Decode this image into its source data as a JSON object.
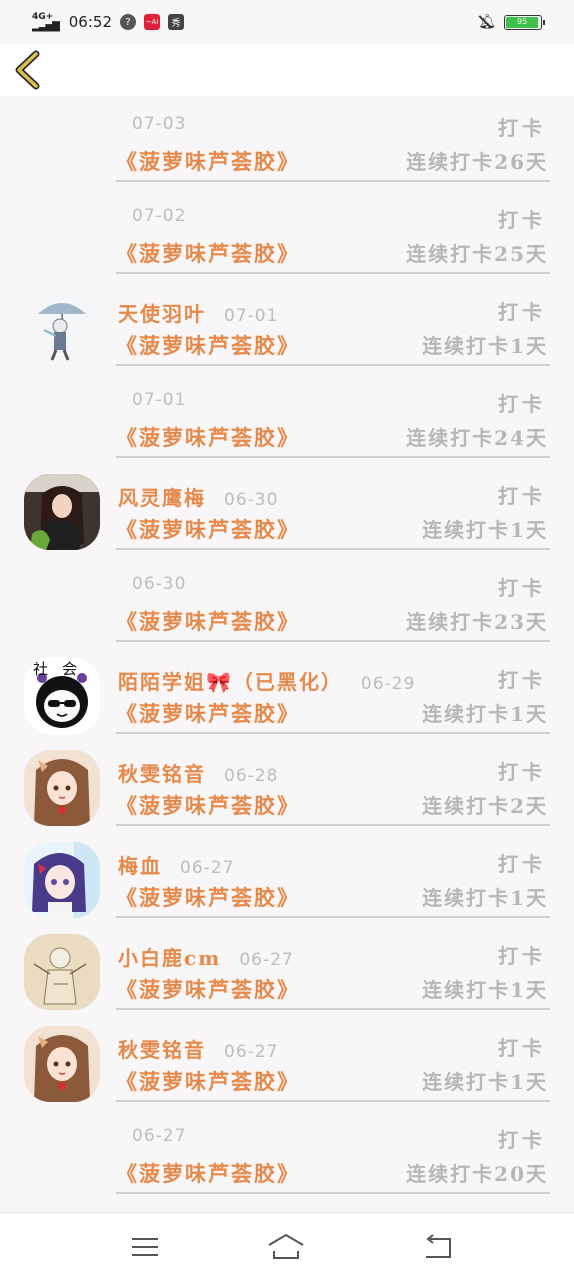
{
  "status_bar": {
    "network": "4G+",
    "time": "06:52",
    "icons": [
      "help-icon",
      "app-red-icon",
      "app-dark-icon"
    ],
    "red_icon_text": "~Ai",
    "dark_icon_text": "秀",
    "battery_level": "95"
  },
  "nav": {
    "back_icon": "chevron-left-icon"
  },
  "entries": [
    {
      "name": "",
      "date": "07-03",
      "tag": "打卡",
      "book": "《菠萝味芦荟胶》",
      "streak": "连续打卡26天",
      "avatar": ""
    },
    {
      "name": "",
      "date": "07-02",
      "tag": "打卡",
      "book": "《菠萝味芦荟胶》",
      "streak": "连续打卡25天",
      "avatar": ""
    },
    {
      "name": "天使羽叶",
      "date": "07-01",
      "tag": "打卡",
      "book": "《菠萝味芦荟胶》",
      "streak": "连续打卡1天",
      "avatar": "umbrella-boy"
    },
    {
      "name": "",
      "date": "07-01",
      "tag": "打卡",
      "book": "《菠萝味芦荟胶》",
      "streak": "连续打卡24天",
      "avatar": ""
    },
    {
      "name": "风灵鹰梅",
      "date": "06-30",
      "tag": "打卡",
      "book": "《菠萝味芦荟胶》",
      "streak": "连续打卡1天",
      "avatar": "dark-hair-girl"
    },
    {
      "name": "",
      "date": "06-30",
      "tag": "打卡",
      "book": "《菠萝味芦荟胶》",
      "streak": "连续打卡23天",
      "avatar": ""
    },
    {
      "name": "陌陌学姐🎀（已黑化）",
      "date": "06-29",
      "tag": "打卡",
      "book": "《菠萝味芦荟胶》",
      "streak": "连续打卡1天",
      "avatar": "sunglasses-girl",
      "avatar_text": "社会"
    },
    {
      "name": "秋雯铭音",
      "date": "06-28",
      "tag": "打卡",
      "book": "《菠萝味芦荟胶》",
      "streak": "连续打卡2天",
      "avatar": "brown-hair-girl"
    },
    {
      "name": "梅血",
      "date": "06-27",
      "tag": "打卡",
      "book": "《菠萝味芦荟胶》",
      "streak": "连续打卡1天",
      "avatar": "purple-hair-girl"
    },
    {
      "name": "小白鹿cm",
      "date": "06-27",
      "tag": "打卡",
      "book": "《菠萝味芦荟胶》",
      "streak": "连续打卡1天",
      "avatar": "sketch-figure"
    },
    {
      "name": "秋雯铭音",
      "date": "06-27",
      "tag": "打卡",
      "book": "《菠萝味芦荟胶》",
      "streak": "连续打卡1天",
      "avatar": "brown-hair-girl"
    },
    {
      "name": "",
      "date": "06-27",
      "tag": "打卡",
      "book": "《菠萝味芦荟胶》",
      "streak": "连续打卡20天",
      "avatar": ""
    }
  ],
  "bottom_nav": {
    "menu_icon": "menu-icon",
    "home_icon": "home-icon",
    "back_icon": "return-icon"
  }
}
